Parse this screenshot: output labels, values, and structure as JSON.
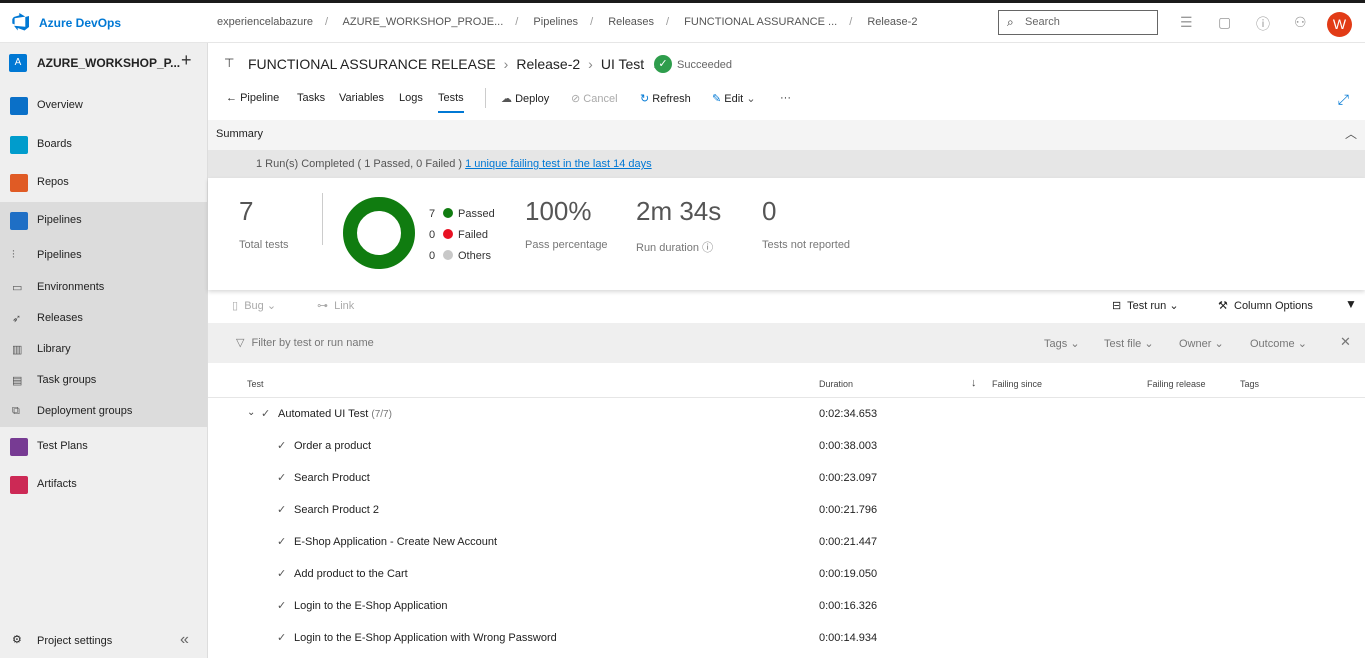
{
  "brand": "Azure DevOps",
  "breadcrumbs": [
    "experiencelabazure",
    "AZURE_WORKSHOP_PROJE...",
    "Pipelines",
    "Releases",
    "FUNCTIONAL ASSURANCE ...",
    "Release-2"
  ],
  "search_placeholder": "Search",
  "avatar_initial": "W",
  "project": {
    "initial": "A",
    "name": "AZURE_WORKSHOP_P..."
  },
  "nav": {
    "overview": "Overview",
    "boards": "Boards",
    "repos": "Repos",
    "pipelines": "Pipelines",
    "sub": [
      "Pipelines",
      "Environments",
      "Releases",
      "Library",
      "Task groups",
      "Deployment groups"
    ],
    "test_plans": "Test Plans",
    "artifacts": "Artifacts",
    "project_settings": "Project settings"
  },
  "title": {
    "release_pipeline": "FUNCTIONAL ASSURANCE RELEASE",
    "release": "Release-2",
    "stage": "UI Test",
    "status": "Succeeded"
  },
  "toolbar": {
    "pipeline": "Pipeline",
    "tasks": "Tasks",
    "variables": "Variables",
    "logs": "Logs",
    "tests": "Tests",
    "deploy": "Deploy",
    "cancel": "Cancel",
    "refresh": "Refresh",
    "edit": "Edit",
    "more": "···"
  },
  "summary": {
    "label": "Summary",
    "run_text": "1 Run(s) Completed ( 1 Passed, 0 Failed )",
    "failing_link": "1 unique failing test in the last 14 days",
    "total_tests": "7",
    "total_tests_label": "Total tests",
    "passed_count": "7",
    "passed_label": "Passed",
    "failed_count": "0",
    "failed_label": "Failed",
    "others_count": "0",
    "others_label": "Others",
    "pass_pct": "100%",
    "pass_pct_label": "Pass percentage",
    "duration": "2m 34s",
    "duration_label": "Run duration",
    "not_reported": "0",
    "not_reported_label": "Tests not reported",
    "colors": {
      "passed": "#107c10",
      "failed": "#e81123",
      "others": "#c8c8c8"
    }
  },
  "actions": {
    "bug": "Bug",
    "link": "Link",
    "test_run": "Test run",
    "column_options": "Column Options"
  },
  "filter": {
    "placeholder": "Filter by test or run name",
    "tags": "Tags",
    "test_file": "Test file",
    "owner": "Owner",
    "outcome": "Outcome"
  },
  "columns": {
    "test": "Test",
    "duration": "Duration",
    "failing_since": "Failing since",
    "failing_release": "Failing release",
    "tags": "Tags"
  },
  "group": {
    "name": "Automated UI Test",
    "count": "(7/7)",
    "duration": "0:02:34.653"
  },
  "tests": [
    {
      "name": "Order a product",
      "duration": "0:00:38.003"
    },
    {
      "name": "Search Product",
      "duration": "0:00:23.097"
    },
    {
      "name": "Search Product 2",
      "duration": "0:00:21.796"
    },
    {
      "name": "E-Shop Application - Create New Account",
      "duration": "0:00:21.447"
    },
    {
      "name": "Add product to the Cart",
      "duration": "0:00:19.050"
    },
    {
      "name": "Login to the E-Shop Application",
      "duration": "0:00:16.326"
    },
    {
      "name": "Login to the E-Shop Application with Wrong Password",
      "duration": "0:00:14.934"
    }
  ]
}
